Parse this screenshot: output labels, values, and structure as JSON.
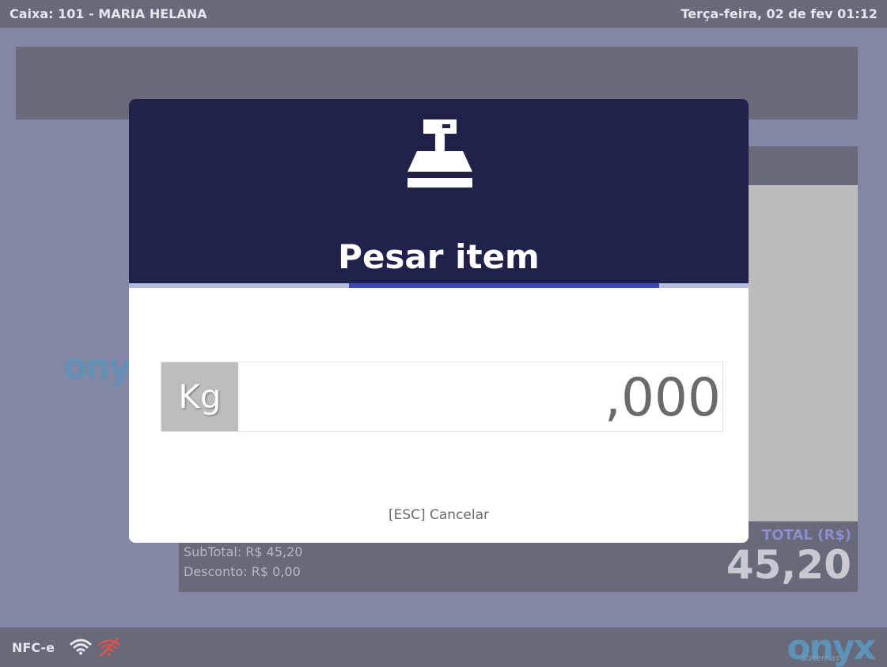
{
  "topbar": {
    "register": "Caixa: 101 - MARIA HELANA",
    "datetime": "Terça-feira, 02 de fev 01:12"
  },
  "totals": {
    "subtotal": "SubTotal: R$ 45,20",
    "desconto": "Desconto: R$ 0,00",
    "total_label": "TOTAL (R$)",
    "total_value": "45,20"
  },
  "bottombar": {
    "fiscal_mode": "NFC-e",
    "brand": "onyx",
    "brand_sub": "sistemas",
    "network_icons": [
      "wifi-icon",
      "wifi-off-icon"
    ]
  },
  "background_logo": "onyx",
  "modal": {
    "icon": "scale-icon",
    "title": "Pesar item",
    "unit": "Kg",
    "weight": ",000",
    "cancel_hint": "[ESC] Cancelar"
  },
  "colors": {
    "header": "#20224c",
    "accent": "#3b46b8",
    "panel": "#686a79",
    "background": "#8386a4",
    "wifi_off": "#d9534f"
  }
}
